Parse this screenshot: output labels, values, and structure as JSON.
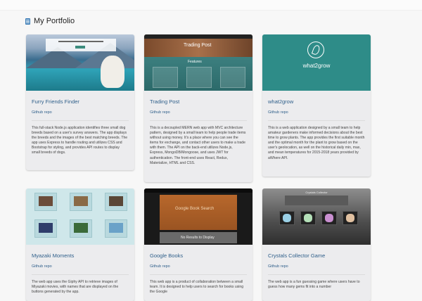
{
  "page": {
    "heading": "My Portfolio"
  },
  "cards": [
    {
      "title": "Furry Friends Finder",
      "link": "Github repo",
      "description": "This full-stack Node.js application identifies three small dog breeds based on a user's survey answers. The app displays the breeds and the images of the best matching breeds. The app uses Express to handle routing and utilizes CSS and Bootstrap for styling, and provides API routes to display small breeds of dogs."
    },
    {
      "title": "Trading Post",
      "link": "Github repo",
      "thumb_title": "Trading Post",
      "thumb_sub": "Features",
      "description": "This is a decoupled MERN web app with MVC architecture pattern, designed by a small team to help people trade items without using money. It's a place where you can see the items for exchange, and contact other users to make a trade with them. The API on the back-end utilizes Node.js, Express, MongoDB/Mongoose, and uses JWT for authentication. The front-end uses React, Redux, Materialize, HTML and CSS."
    },
    {
      "title": "what2grow",
      "link": "Github repo",
      "thumb_title": "what2grow",
      "description": "This is a web application designed by a small team to help amateur gardeners make informed decisions about the best time to grow plants. The app provides the first suitable month and the optimal month for the plant to grow based on the user's geolocation, as well on the historical daily min, max, and mean temperatures for 2015-2018 years provided by aWhere API."
    },
    {
      "title": "Myazaki Moments",
      "link": "Github repo",
      "description": "The web app uses the Giphy API to retrieve images of Miyazaki movies, with names that are displayed on the buttons generated by the app."
    },
    {
      "title": "Google Books",
      "link": "Github repo",
      "thumb_title": "Google Book Search",
      "thumb_results": "No Results to Display",
      "description": "This web app is a product of collaboration between a small team. It is designed to help users to search for books using the Google"
    },
    {
      "title": "Crystals Collector Game",
      "link": "Github repo",
      "thumb_title": "Crystals Collector",
      "description": "The web app is a fun guessing game where users have to guess how many gems fit into a number"
    }
  ]
}
